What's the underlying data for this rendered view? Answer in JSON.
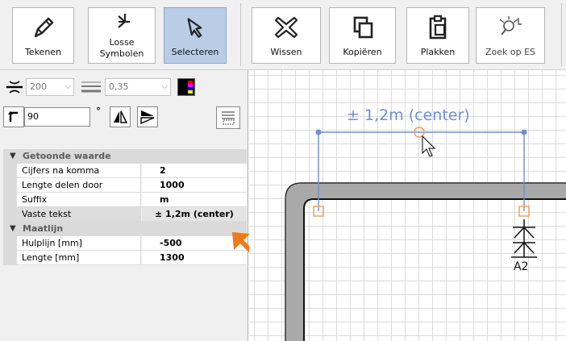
{
  "toolbar": {
    "buttons": [
      {
        "id": "tekenen",
        "label": "Tekenen",
        "icon": "pencil-icon",
        "active": false
      },
      {
        "id": "losse-symbolen",
        "label_line1": "Losse",
        "label_line2": "Symbolen",
        "icon": "symbol-icon",
        "active": false
      },
      {
        "id": "selecteren",
        "label": "Selecteren",
        "icon": "cursor-select-icon",
        "active": true
      },
      {
        "id": "wissen",
        "label": "Wissen",
        "icon": "delete-x-icon",
        "active": false
      },
      {
        "id": "kopieren",
        "label": "Kopiëren",
        "icon": "copy-icon",
        "active": false
      },
      {
        "id": "plakken",
        "label": "Plakken",
        "icon": "paste-icon",
        "active": false
      },
      {
        "id": "zoek-op-es",
        "label": "Zoek op ES",
        "icon": "search-es-icon",
        "active": false,
        "disabled": true
      }
    ]
  },
  "panel": {
    "line_length_value": "200",
    "line_width_value": "0,35",
    "rotation_value": "90",
    "degree_symbol": "°",
    "colors": {
      "accent_active": "#b9cde6",
      "dimension_line": "#6d8fd6",
      "handle": "#f0a060",
      "arrow": "#f07a1a"
    }
  },
  "properties": {
    "categories": [
      {
        "title": "Getoonde waarde",
        "rows": [
          {
            "name": "Cijfers na komma",
            "value": "2"
          },
          {
            "name": "Lengte delen door",
            "value": "1000"
          },
          {
            "name": "Suffix",
            "value": "m"
          },
          {
            "name": "Vaste tekst",
            "value": "± 1,2m (center)",
            "selected": true
          }
        ]
      },
      {
        "title": "Maatlijn",
        "rows": [
          {
            "name": "Hulplijn [mm]",
            "value": "-500"
          },
          {
            "name": "Lengte [mm]",
            "value": "1300"
          }
        ]
      }
    ]
  },
  "canvas": {
    "dimension_text": "± 1,2m (center)",
    "symbol_label": "A2"
  }
}
